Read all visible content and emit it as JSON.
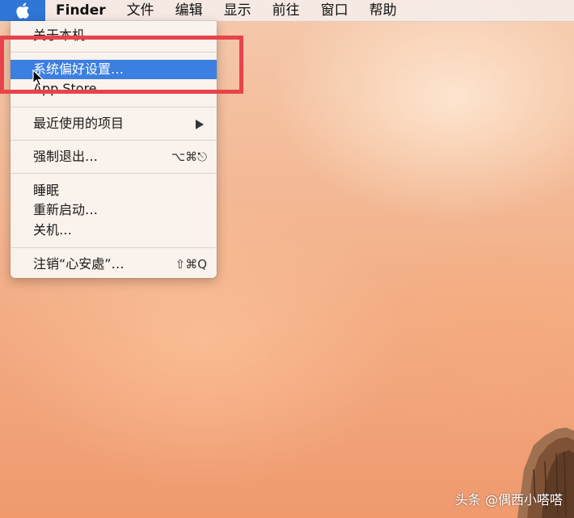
{
  "menubar": {
    "app_name": "Finder",
    "menus": [
      "文件",
      "编辑",
      "显示",
      "前往",
      "窗口",
      "帮助"
    ]
  },
  "apple_menu": {
    "about": "关于本机",
    "system_prefs": "系统偏好设置…",
    "app_store": "App Store",
    "recent_items": "最近使用的项目",
    "force_quit": "强制退出…",
    "force_quit_shortcut": "⌥⌘⎋",
    "sleep": "睡眠",
    "restart": "重新启动…",
    "shutdown": "关机…",
    "logout": "注销“心安處”…",
    "logout_shortcut": "⇧⌘Q"
  },
  "watermark": "头条 @偶西小嗒嗒",
  "colors": {
    "apple_highlight": "#2f76d6",
    "menu_highlight": "#3b7fe0",
    "annotation_box": "#e8434a"
  }
}
